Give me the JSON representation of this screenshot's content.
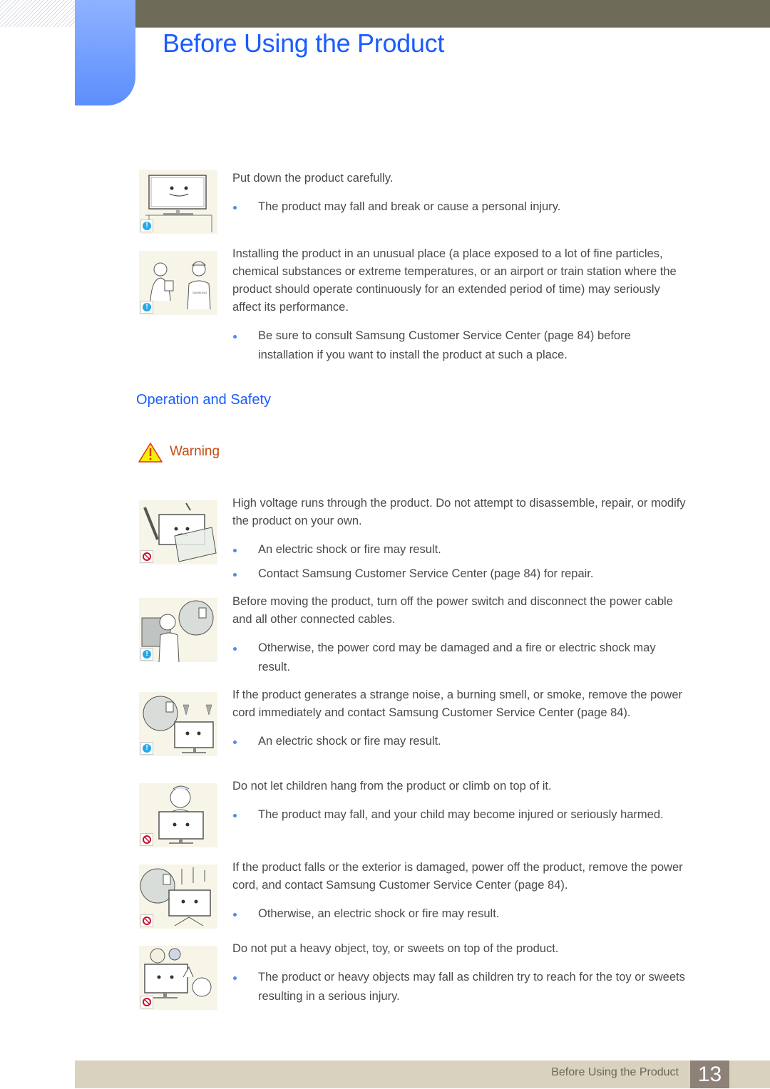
{
  "header": {
    "title": "Before Using the Product",
    "colors": {
      "title": "#1a5cff",
      "bar": "#6e6c58",
      "tab": "#5b8ffc"
    }
  },
  "blocks_intro": [
    {
      "icon": "info",
      "illustration": "monitor-on-stand-edge",
      "text": "Put down the product carefully.",
      "bullets": [
        "The product may fall and break or cause a personal injury."
      ]
    },
    {
      "icon": "info",
      "illustration": "customer-calling-service",
      "text": "Installing the product in an unusual place (a place exposed to a lot of fine particles, chemical substances or extreme temperatures, or an airport or train station where the product should operate continuously for an extended period of time) may seriously affect its performance.",
      "bullets": [
        "Be sure to consult Samsung Customer Service Center (page 84) before installation if you want to install the product at such a place."
      ]
    }
  ],
  "section": {
    "heading": "Operation and Safety",
    "warning_label": "Warning"
  },
  "blocks_safety": [
    {
      "icon": "prohibit",
      "illustration": "disassembling-monitor",
      "text": "High voltage runs through the product. Do not attempt to disassemble, repair, or modify the product on your own.",
      "bullets": [
        "An electric shock or fire may result.",
        "Contact Samsung Customer Service Center (page 84) for repair."
      ]
    },
    {
      "icon": "info",
      "illustration": "unplugging-before-moving",
      "text": "Before moving the product, turn off the power switch and disconnect the power cable and all other connected cables.",
      "bullets": [
        "Otherwise, the power cord may be damaged and a fire or electric shock may result."
      ]
    },
    {
      "icon": "info",
      "illustration": "smoke-unplug",
      "text": "If the product generates a strange noise, a burning smell, or smoke, remove the power cord immediately and contact Samsung Customer Service Center (page 84).",
      "bullets": [
        "An electric shock or fire may result."
      ]
    },
    {
      "icon": "prohibit",
      "illustration": "child-climbing-monitor",
      "text": "Do not let children hang from the product or climb on top of it.",
      "bullets": [
        "The product may fall, and your child may become injured or seriously harmed."
      ]
    },
    {
      "icon": "prohibit",
      "illustration": "fallen-monitor-unplug",
      "text": "If the product falls or the exterior is damaged, power off the product, remove the power cord, and contact Samsung Customer Service Center (page 84).",
      "bullets": [
        "Otherwise, an electric shock or fire may result."
      ]
    },
    {
      "icon": "prohibit",
      "illustration": "toys-on-monitor",
      "text": "Do not put a heavy object, toy, or sweets on top of the product.",
      "bullets": [
        "The product or heavy objects may fall as children try to reach for the toy or sweets resulting in a serious injury."
      ]
    }
  ],
  "footer": {
    "label": "Before Using the Product",
    "page_number": "13"
  }
}
